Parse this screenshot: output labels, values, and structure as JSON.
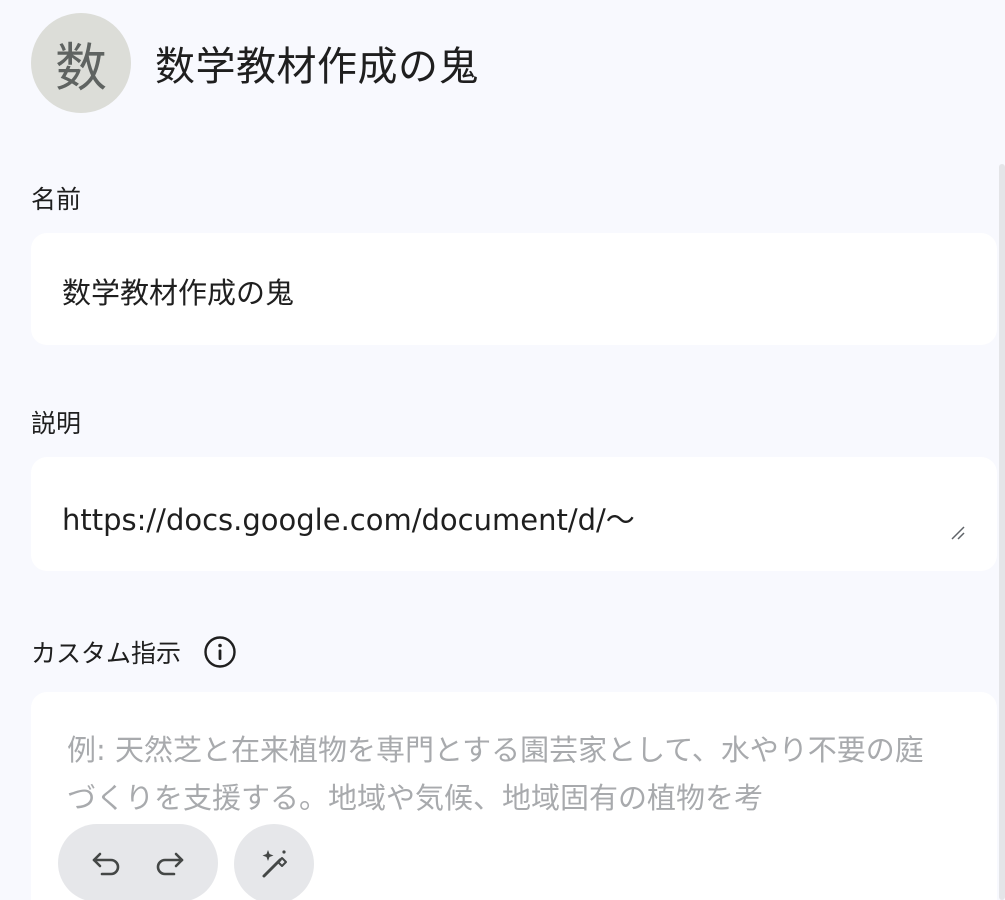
{
  "header": {
    "avatar_letter": "数",
    "title": "数学教材作成の鬼"
  },
  "name_section": {
    "label": "名前",
    "value": "数学教材作成の鬼"
  },
  "description_section": {
    "label": "説明",
    "value": "https://docs.google.com/document/d/〜"
  },
  "instructions_section": {
    "label": "カスタム指示",
    "placeholder": "例: 天然芝と在来植物を専門とする園芸家として、水やり不要の庭づくりを支援する。地域や気候、地域固有の植物を考"
  },
  "icons": {
    "info": "info-icon",
    "undo": "undo-icon",
    "redo": "redo-icon",
    "magic": "magic-wand-icon",
    "resize": "resize-handle-icon"
  },
  "colors": {
    "background": "#f8f9fe",
    "field": "#ffffff",
    "avatar": "#dcddd8",
    "placeholder": "#a8aaad",
    "button": "#e6e7ea"
  }
}
